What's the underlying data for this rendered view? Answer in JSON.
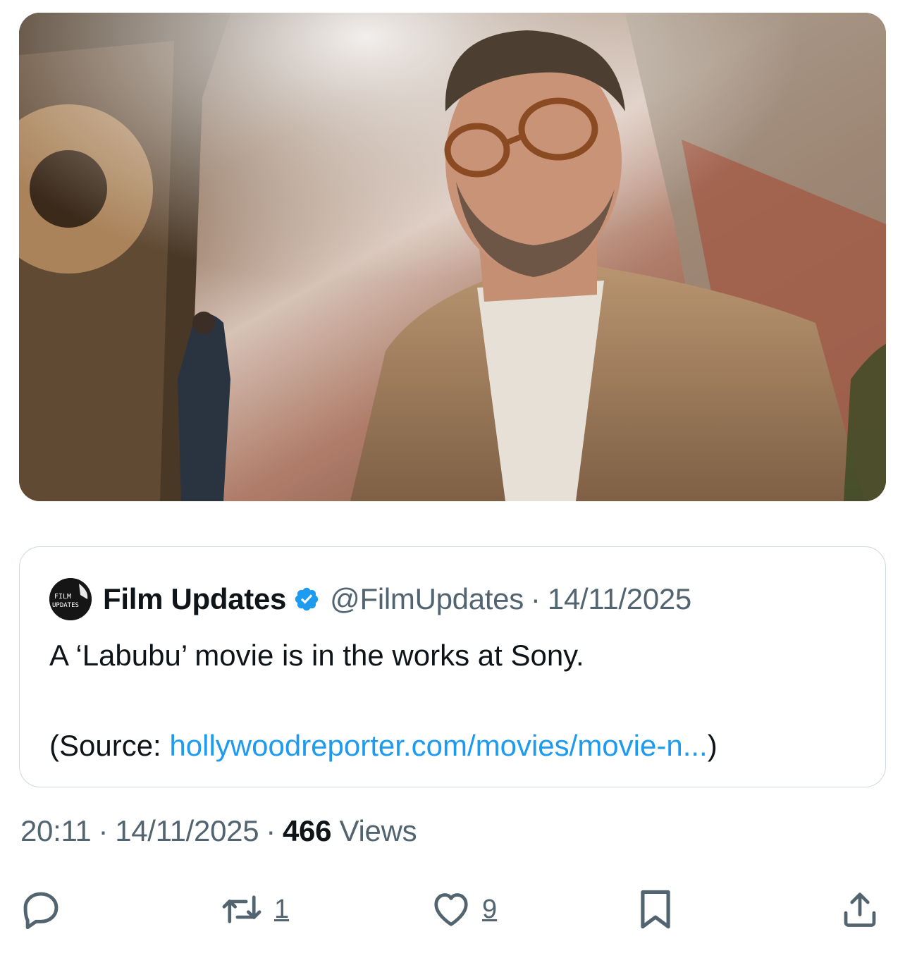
{
  "media": {
    "alt_icon": "photo"
  },
  "quote": {
    "author_name": "Film Updates",
    "handle": "@FilmUpdates",
    "separator": "·",
    "date": "14/11/2025",
    "avatar_text_1": "FILM",
    "avatar_text_2": "UPDATES",
    "text_line1": "A ‘Labubu’ movie is in the works at Sony.",
    "source_prefix": "(Source: ",
    "source_link": "hollywoodreporter.com/movies/movie-n...",
    "source_suffix": ")"
  },
  "meta": {
    "time": "20:11",
    "sep1": "·",
    "date": "14/11/2025",
    "sep2": "·",
    "views_count": "466",
    "views_label": " Views"
  },
  "actions": {
    "retweets": "1",
    "likes": "9"
  },
  "colors": {
    "link": "#1d9bf0",
    "secondary": "#536471",
    "primary": "#0f1419",
    "verified": "#1d9bf0"
  }
}
